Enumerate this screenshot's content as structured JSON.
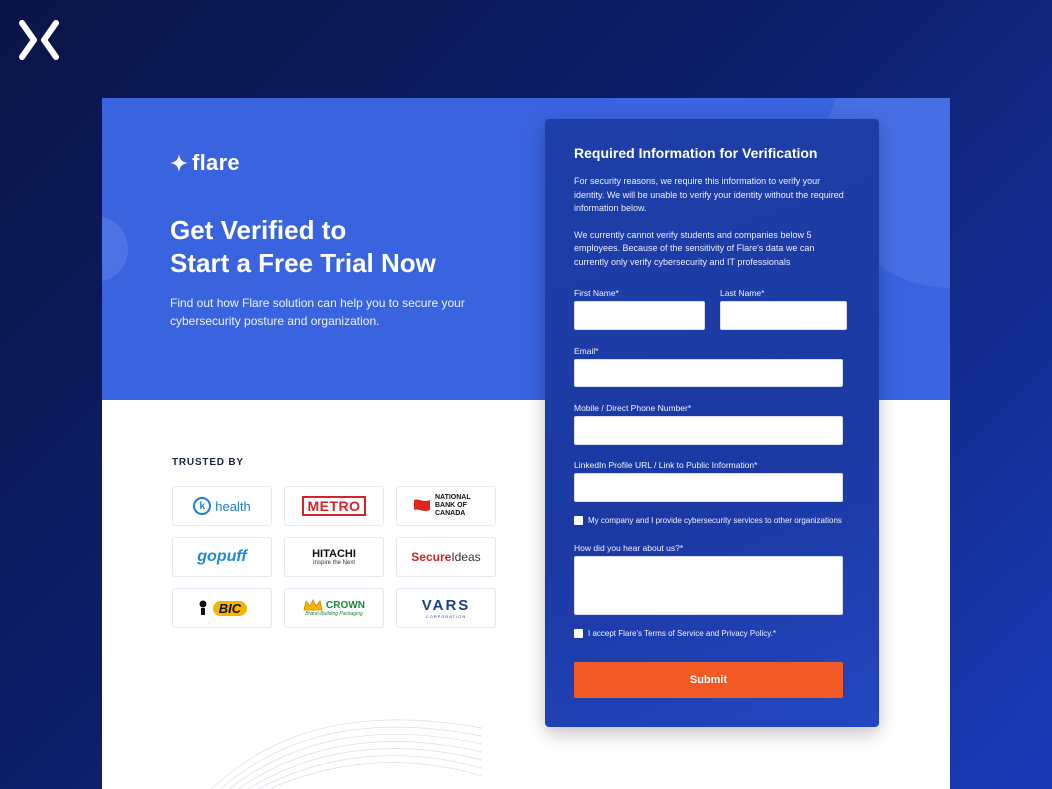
{
  "brand": {
    "name": "flare"
  },
  "hero": {
    "headline_line1": "Get Verified to",
    "headline_line2": "Start a Free Trial Now",
    "subtitle": "Find out how Flare solution can help you to secure your cybersecurity posture and organization."
  },
  "trusted": {
    "heading": "TRUSTED BY",
    "logos": [
      {
        "text": "health",
        "mark": "k",
        "color": "#1a7fd6"
      },
      {
        "text": "METRO",
        "color": "#d5232a"
      },
      {
        "text": "NATIONAL BANK OF CANADA",
        "color": "#111111",
        "accent": "#e2231a"
      },
      {
        "text": "gopuff",
        "color": "#1e8ad9"
      },
      {
        "text": "HITACHI",
        "sub": "Inspire the Next",
        "color": "#111111"
      },
      {
        "text_a": "Secure",
        "text_b": "Ideas",
        "color_a": "#d5232a",
        "color_b": "#333333"
      },
      {
        "text": "BIC",
        "color": "#f7b500"
      },
      {
        "text": "CROWN",
        "sub": "Brand-Building Packaging",
        "color": "#1a8a3a"
      },
      {
        "text": "VARS",
        "sub": "CORPORATION",
        "color": "#1d3f8f"
      }
    ]
  },
  "form": {
    "title": "Required Information for Verification",
    "intro_1": "For security reasons, we require this  information to verify your identity. We will be unable to verify your  identity without the required information below.",
    "intro_2": "We currently cannot verify students and companies below 5 employees. Because of the sensitivity of Flare's data we can currently only verify cybersecurity and IT professionals",
    "first_name_label": "First Name*",
    "first_name_value": "",
    "last_name_label": "Last Name*",
    "last_name_value": "",
    "email_label": "Email*",
    "email_value": "",
    "phone_label": "Mobile / Direct Phone Number*",
    "phone_value": "",
    "linkedin_label": "LinkedIn Profile URL / Link to Public Information*",
    "linkedin_value": "",
    "provider_checkbox_label": "My company and I provide cybersecurity services to other organizations",
    "hear_label": "How did you hear about us?*",
    "hear_value": "",
    "terms_checkbox_label": "I accept Flare's Terms of Service and Privacy Policy.*",
    "submit_label": "Submit"
  },
  "colors": {
    "hero_blue": "#3a63e0",
    "panel_blue": "#1f3fa8",
    "submit_orange": "#f15a24"
  }
}
